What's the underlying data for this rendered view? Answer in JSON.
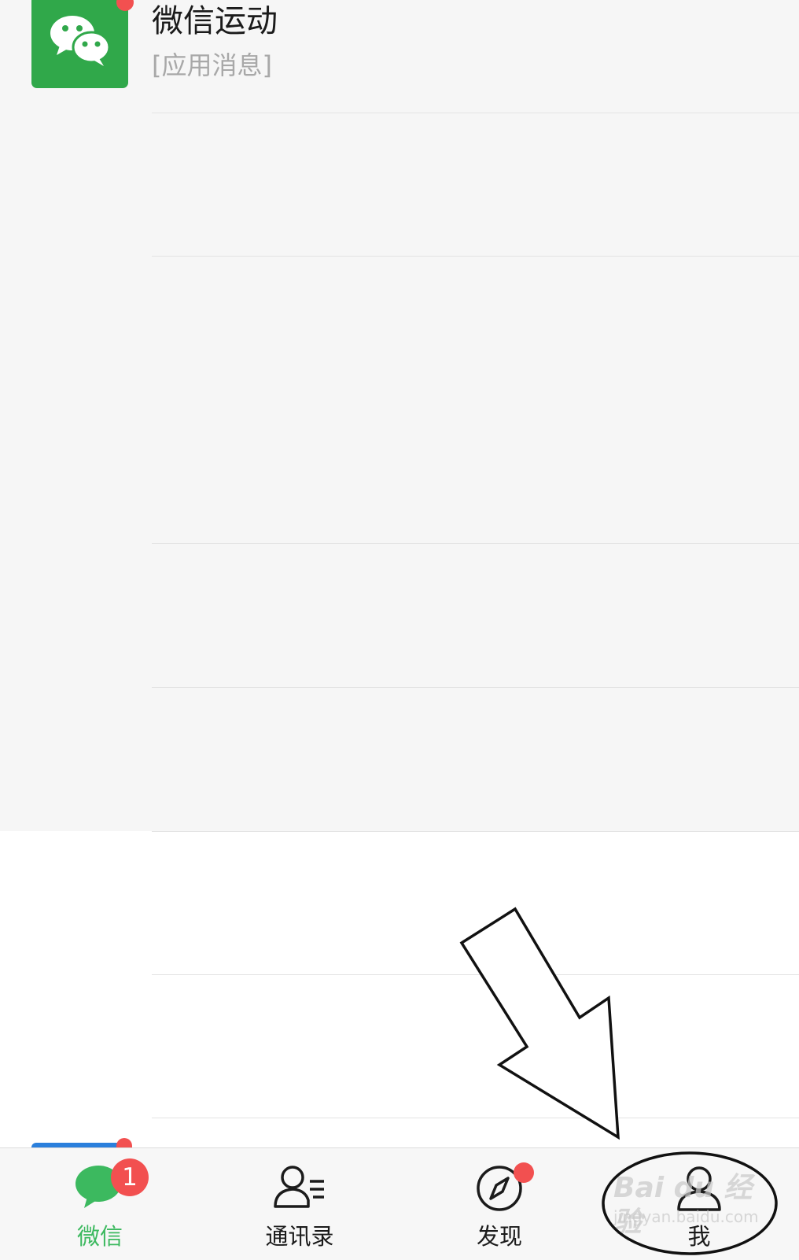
{
  "chat_list": {
    "items": [
      {
        "name": "微信运动",
        "preview": "[应用消息]",
        "icon": "wechat-logo-icon",
        "unread_dot": true
      }
    ]
  },
  "tabbar": {
    "tabs": [
      {
        "label": "微信",
        "icon": "chat-bubble-icon",
        "active": true,
        "badge": "1"
      },
      {
        "label": "通讯录",
        "icon": "contacts-icon",
        "active": false
      },
      {
        "label": "发现",
        "icon": "compass-icon",
        "active": false,
        "dot": true
      },
      {
        "label": "我",
        "icon": "person-icon",
        "active": false
      }
    ]
  },
  "watermark": {
    "main": "Bai du 经验",
    "sub": "jingyan.baidu.com"
  },
  "colors": {
    "accent": "#3cb95f",
    "badge": "#f25050",
    "app_icon": "#30a84a"
  }
}
